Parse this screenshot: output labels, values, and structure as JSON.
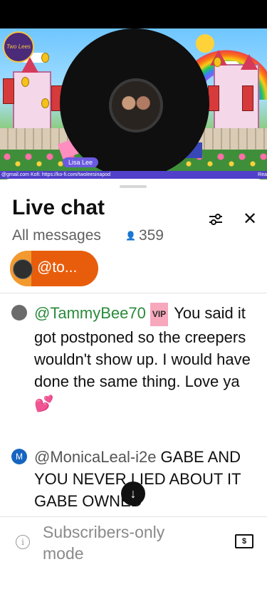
{
  "video": {
    "presenter_name": "Lisa Lee",
    "ticker_left": "@gmail.com Kofi: https://ko-fi.com/twoleesinapod",
    "ticker_right": "Rea",
    "logo_text": "Two Lees"
  },
  "chat": {
    "title": "Live chat",
    "filter_label": "All messages",
    "viewer_count": "359",
    "pinned_label": "@to..."
  },
  "messages": [
    {
      "author": "@TammyBee70",
      "badge": "VIP",
      "text": "You said it got postponed so the creepers wouldn't show up. I would have done the same thing. Love ya",
      "emoji": "💕"
    },
    {
      "author": "@MonicaLeal-i2e",
      "avatar_letter": "M",
      "avatar_color": "#1565c0",
      "text": "GABE AND YOU NEVER LIED ABOUT IT GABE OWNED"
    }
  ],
  "footer": {
    "mode_text": "Subscribers-only mode"
  },
  "colors": {
    "pinned_bg": "#e85d0b",
    "author_green": "#2a8a3b",
    "ticker_bg": "#5140c9"
  }
}
